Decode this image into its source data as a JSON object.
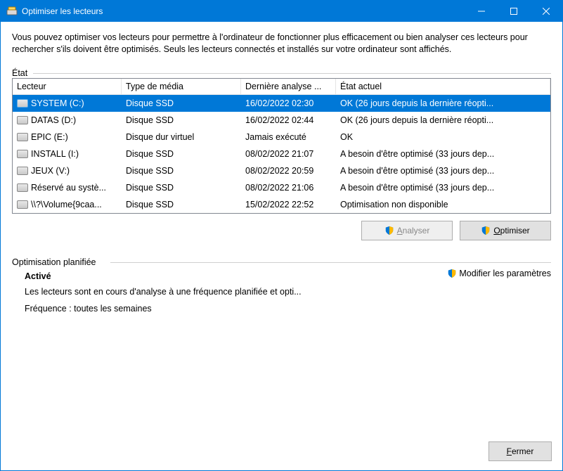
{
  "window": {
    "title": "Optimiser les lecteurs"
  },
  "intro": "Vous pouvez optimiser vos lecteurs pour permettre à l'ordinateur de fonctionner plus efficacement ou bien analyser ces lecteurs pour rechercher s'ils doivent être optimisés. Seuls les lecteurs connectés et installés sur votre ordinateur sont affichés.",
  "status_label": "État",
  "columns": {
    "drive": "Lecteur",
    "media": "Type de média",
    "last": "Dernière analyse ...",
    "status": "État actuel"
  },
  "drives": [
    {
      "name": "SYSTEM (C:)",
      "media": "Disque SSD",
      "last": "16/02/2022 02:30",
      "status": "OK (26 jours depuis la dernière réopti...",
      "selected": true
    },
    {
      "name": "DATAS (D:)",
      "media": "Disque SSD",
      "last": "16/02/2022 02:44",
      "status": "OK (26 jours depuis la dernière réopti...",
      "selected": false
    },
    {
      "name": "EPIC (E:)",
      "media": "Disque dur virtuel",
      "last": "Jamais exécuté",
      "status": "OK",
      "selected": false
    },
    {
      "name": "INSTALL (I:)",
      "media": "Disque SSD",
      "last": "08/02/2022 21:07",
      "status": "A besoin d'être optimisé (33 jours dep...",
      "selected": false
    },
    {
      "name": "JEUX (V:)",
      "media": "Disque SSD",
      "last": "08/02/2022 20:59",
      "status": "A besoin d'être optimisé (33 jours dep...",
      "selected": false
    },
    {
      "name": "Réservé au systè...",
      "media": "Disque SSD",
      "last": "08/02/2022 21:06",
      "status": "A besoin d'être optimisé (33 jours dep...",
      "selected": false
    },
    {
      "name": "\\\\?\\Volume{9caa...",
      "media": "Disque SSD",
      "last": "15/02/2022 22:52",
      "status": "Optimisation non disponible",
      "selected": false
    }
  ],
  "buttons": {
    "analyze": "Analyser",
    "optimize": "Optimiser",
    "change_settings": "Modifier les paramètres",
    "close": "Fermer"
  },
  "schedule": {
    "section_label": "Optimisation planifiée",
    "title": "Activé",
    "line1": "Les lecteurs sont en cours d'analyse à une fréquence planifiée et opti...",
    "line2": "Fréquence : toutes les semaines"
  }
}
